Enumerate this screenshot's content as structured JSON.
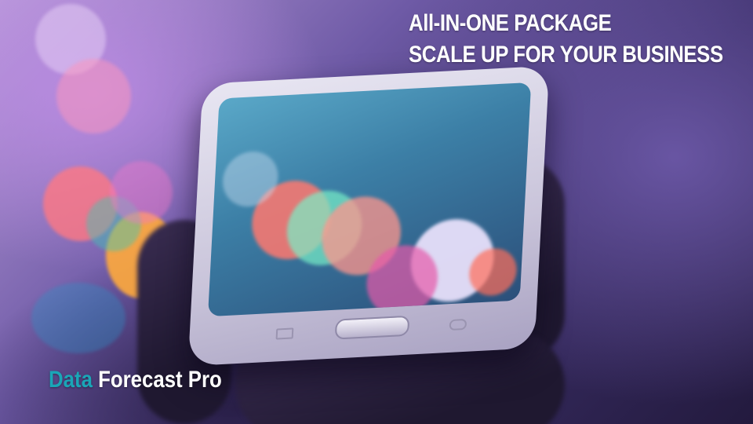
{
  "headline": {
    "line1": "All-IN-ONE PACKAGE",
    "line2": "SCALE UP FOR YOUR BUSINESS"
  },
  "brand": {
    "word1": "Data",
    "word2": " Forecast Pro",
    "accent_color": "#1aa6b7",
    "text_color": "#ffffff"
  },
  "background": {
    "photo_subject": "hand-holding-smartphone-with-bokeh-lights"
  }
}
